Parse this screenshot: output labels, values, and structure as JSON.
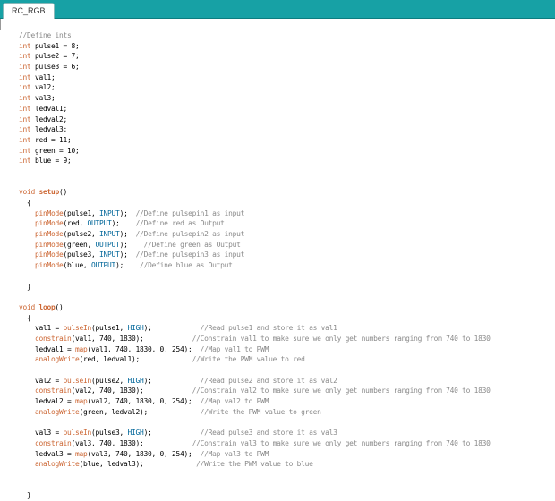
{
  "tab": {
    "title": "RC_RGB"
  },
  "code": [
    [
      {
        "t": "//Define ints",
        "c": "cmt"
      }
    ],
    [
      {
        "t": "int",
        "c": "kw"
      },
      {
        "t": " pulse1 = 8;"
      }
    ],
    [
      {
        "t": "int",
        "c": "kw"
      },
      {
        "t": " pulse2 = 7;"
      }
    ],
    [
      {
        "t": "int",
        "c": "kw"
      },
      {
        "t": " pulse3 = 6;"
      }
    ],
    [
      {
        "t": "int",
        "c": "kw"
      },
      {
        "t": " val1;"
      }
    ],
    [
      {
        "t": "int",
        "c": "kw"
      },
      {
        "t": " val2;"
      }
    ],
    [
      {
        "t": "int",
        "c": "kw"
      },
      {
        "t": " val3;"
      }
    ],
    [
      {
        "t": "int",
        "c": "kw"
      },
      {
        "t": " ledval1;"
      }
    ],
    [
      {
        "t": "int",
        "c": "kw"
      },
      {
        "t": " ledval2;"
      }
    ],
    [
      {
        "t": "int",
        "c": "kw"
      },
      {
        "t": " ledval3;"
      }
    ],
    [
      {
        "t": "int",
        "c": "kw"
      },
      {
        "t": " red = 11;"
      }
    ],
    [
      {
        "t": "int",
        "c": "kw"
      },
      {
        "t": " green = 10;"
      }
    ],
    [
      {
        "t": "int",
        "c": "kw"
      },
      {
        "t": " blue = 9;"
      }
    ],
    [],
    [],
    [
      {
        "t": "void",
        "c": "kw"
      },
      {
        "t": " "
      },
      {
        "t": "setup",
        "c": "fnb"
      },
      {
        "t": "()"
      }
    ],
    [
      {
        "t": "  {"
      }
    ],
    [
      {
        "t": "    "
      },
      {
        "t": "pinMode",
        "c": "fn"
      },
      {
        "t": "(pulse1, "
      },
      {
        "t": "INPUT",
        "c": "cst"
      },
      {
        "t": ");  "
      },
      {
        "t": "//Define pulsepin1 as input",
        "c": "cmt"
      }
    ],
    [
      {
        "t": "    "
      },
      {
        "t": "pinMode",
        "c": "fn"
      },
      {
        "t": "(red, "
      },
      {
        "t": "OUTPUT",
        "c": "cst"
      },
      {
        "t": ");    "
      },
      {
        "t": "//Define red as Output",
        "c": "cmt"
      }
    ],
    [
      {
        "t": "    "
      },
      {
        "t": "pinMode",
        "c": "fn"
      },
      {
        "t": "(pulse2, "
      },
      {
        "t": "INPUT",
        "c": "cst"
      },
      {
        "t": ");  "
      },
      {
        "t": "//Define pulsepin2 as input",
        "c": "cmt"
      }
    ],
    [
      {
        "t": "    "
      },
      {
        "t": "pinMode",
        "c": "fn"
      },
      {
        "t": "(green, "
      },
      {
        "t": "OUTPUT",
        "c": "cst"
      },
      {
        "t": ");    "
      },
      {
        "t": "//Define green as Output",
        "c": "cmt"
      }
    ],
    [
      {
        "t": "    "
      },
      {
        "t": "pinMode",
        "c": "fn"
      },
      {
        "t": "(pulse3, "
      },
      {
        "t": "INPUT",
        "c": "cst"
      },
      {
        "t": ");  "
      },
      {
        "t": "//Define pulsepin3 as input",
        "c": "cmt"
      }
    ],
    [
      {
        "t": "    "
      },
      {
        "t": "pinMode",
        "c": "fn"
      },
      {
        "t": "(blue, "
      },
      {
        "t": "OUTPUT",
        "c": "cst"
      },
      {
        "t": ");    "
      },
      {
        "t": "//Define blue as Output",
        "c": "cmt"
      }
    ],
    [],
    [
      {
        "t": "  }"
      }
    ],
    [],
    [
      {
        "t": "void",
        "c": "kw"
      },
      {
        "t": " "
      },
      {
        "t": "loop",
        "c": "fnb"
      },
      {
        "t": "()"
      }
    ],
    [
      {
        "t": "  {"
      }
    ],
    [
      {
        "t": "    val1 = "
      },
      {
        "t": "pulseIn",
        "c": "fn"
      },
      {
        "t": "(pulse1, "
      },
      {
        "t": "HIGH",
        "c": "cst"
      },
      {
        "t": ");            "
      },
      {
        "t": "//Read pulse1 and store it as val1",
        "c": "cmt"
      }
    ],
    [
      {
        "t": "    "
      },
      {
        "t": "constrain",
        "c": "fn"
      },
      {
        "t": "(val1, 740, 1830);            "
      },
      {
        "t": "//Constrain val1 to make sure we only get numbers ranging from 740 to 1830",
        "c": "cmt"
      }
    ],
    [
      {
        "t": "    ledval1 = "
      },
      {
        "t": "map",
        "c": "fn"
      },
      {
        "t": "(val1, 740, 1830, 0, 254);  "
      },
      {
        "t": "//Map val1 to PWM",
        "c": "cmt"
      }
    ],
    [
      {
        "t": "    "
      },
      {
        "t": "analogWrite",
        "c": "fn"
      },
      {
        "t": "(red, ledval1);             "
      },
      {
        "t": "//Write the PWM value to red",
        "c": "cmt"
      }
    ],
    [],
    [
      {
        "t": "    val2 = "
      },
      {
        "t": "pulseIn",
        "c": "fn"
      },
      {
        "t": "(pulse2, "
      },
      {
        "t": "HIGH",
        "c": "cst"
      },
      {
        "t": ");            "
      },
      {
        "t": "//Read pulse2 and store it as val2",
        "c": "cmt"
      }
    ],
    [
      {
        "t": "    "
      },
      {
        "t": "constrain",
        "c": "fn"
      },
      {
        "t": "(val2, 740, 1830);            "
      },
      {
        "t": "//Constrain val2 to make sure we only get numbers ranging from 740 to 1830",
        "c": "cmt"
      }
    ],
    [
      {
        "t": "    ledval2 = "
      },
      {
        "t": "map",
        "c": "fn"
      },
      {
        "t": "(val2, 740, 1830, 0, 254);  "
      },
      {
        "t": "//Map val2 to PWM",
        "c": "cmt"
      }
    ],
    [
      {
        "t": "    "
      },
      {
        "t": "analogWrite",
        "c": "fn"
      },
      {
        "t": "(green, ledval2);             "
      },
      {
        "t": "//Write the PWM value to green",
        "c": "cmt"
      }
    ],
    [],
    [
      {
        "t": "    val3 = "
      },
      {
        "t": "pulseIn",
        "c": "fn"
      },
      {
        "t": "(pulse3, "
      },
      {
        "t": "HIGH",
        "c": "cst"
      },
      {
        "t": ");            "
      },
      {
        "t": "//Read pulse3 and store it as val3",
        "c": "cmt"
      }
    ],
    [
      {
        "t": "    "
      },
      {
        "t": "constrain",
        "c": "fn"
      },
      {
        "t": "(val3, 740, 1830);            "
      },
      {
        "t": "//Constrain val3 to make sure we only get numbers ranging from 740 to 1830",
        "c": "cmt"
      }
    ],
    [
      {
        "t": "    ledval3 = "
      },
      {
        "t": "map",
        "c": "fn"
      },
      {
        "t": "(val3, 740, 1830, 0, 254);  "
      },
      {
        "t": "//Map val3 to PWM",
        "c": "cmt"
      }
    ],
    [
      {
        "t": "    "
      },
      {
        "t": "analogWrite",
        "c": "fn"
      },
      {
        "t": "(blue, ledval3);             "
      },
      {
        "t": "//Write the PWM value to blue",
        "c": "cmt"
      }
    ],
    [],
    [],
    [
      {
        "t": "  }"
      }
    ]
  ]
}
